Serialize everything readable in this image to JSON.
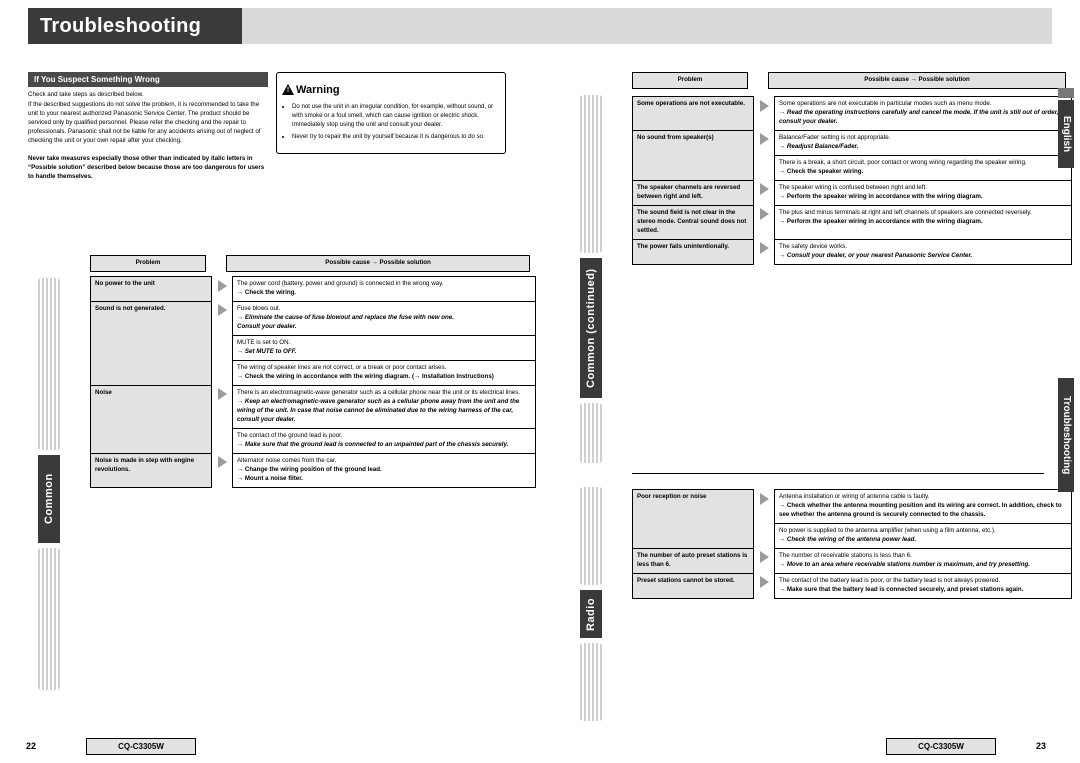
{
  "header": {
    "title": "Troubleshooting"
  },
  "left": {
    "section_title": "If You Suspect Something Wrong",
    "intro": "Check and take steps as described below.",
    "para1": "If the described suggestions do not solve the problem, it is recommended to take the unit to your nearest authorized Panasonic Service Center. The product should be serviced only by qualified personnel. Please refer the checking and the repair to professionals. Panasonic shall not be liable for any accidents arising out of neglect of checking the unit or your own repair after your checking.",
    "para2_bold": "Never take measures especially those other than indicated by italic letters in “Possible solution” described below because those are too dangerous for users to handle themselves.",
    "warning": {
      "title": "Warning",
      "items": [
        "Do not use the unit in an irregular condition, for example, without sound, or with smoke or a foul smell, which can cause ignition or electric shock. Immediately stop using the unit and consult your dealer.",
        "Never try to repair the unit by yourself because it is dangerous to do so."
      ]
    },
    "table_headers": {
      "problem": "Problem",
      "solution": "Possible cause → Possible solution"
    },
    "tab_label": "Common",
    "rows": [
      {
        "problem": "No power to the unit",
        "cells": [
          {
            "cause": "The power cord (battery, power and ground) is connected in the wrong way.",
            "sol": "→ Check the wiring.",
            "sol_style": "bold"
          }
        ]
      },
      {
        "problem": "Sound is not generated.",
        "cells": [
          {
            "cause": "Fuse blows out.",
            "sol": "→ Eliminate the cause of fuse blowout and replace the fuse with new one.",
            "sol2": "Consult your dealer.",
            "sol_style": "bolditalic"
          },
          {
            "cause": "MUTE is set to ON.",
            "sol": "→ Set MUTE to OFF.",
            "sol_style": "bolditalic"
          },
          {
            "cause": "The wiring of speaker lines are not correct, or a break or poor contact arises.",
            "sol": "→ Check the wiring in accordance with the wiring diagram. (→ Installation Instructions)",
            "sol_style": "bold"
          }
        ]
      },
      {
        "problem": "Noise",
        "cells": [
          {
            "cause": "There is an electromagnetic-wave generator such as a cellular phone near the unit or its electrical lines.",
            "sol": "→ Keep an electromagnetic-wave generator such as a cellular phone away from the unit and the wiring of the unit. In case that noise cannot be eliminated due to the wiring harness of the car, consult your dealer.",
            "sol_style": "bolditalic"
          },
          {
            "cause": "The contact of the ground lead is poor.",
            "sol": "→ Make sure that the ground lead is connected to an unpainted part of the chassis securely.",
            "sol_style": "bolditalic"
          }
        ]
      },
      {
        "problem": "Noise is made in step with engine revolutions.",
        "cells": [
          {
            "cause": "Alternator noise comes from the car.",
            "sol": "→ Change the wiring position of the ground lead.",
            "sol2": "→ Mount a noise filter.",
            "sol_style": "bold"
          }
        ]
      }
    ],
    "footer": {
      "page": "22",
      "model": "CQ-C3305W"
    }
  },
  "right": {
    "table_headers": {
      "problem": "Problem",
      "solution": "Possible cause → Possible solution"
    },
    "tab_common": "Common (continued)",
    "tab_radio": "Radio",
    "common_rows": [
      {
        "problem": "Some operations are not executable.",
        "cells": [
          {
            "cause": "Some operations are not executable in particular modes such as menu mode.",
            "sol": "→ Read the operating instructions carefully and cancel the mode. If the unit is still out of order, consult your dealer.",
            "sol_style": "bolditalic"
          }
        ]
      },
      {
        "problem": "No sound from speaker(s)",
        "cells": [
          {
            "cause": "Balance/Fader setting is not appropriate.",
            "sol": "→ Readjust Balance/Fader.",
            "sol_style": "bolditalic"
          },
          {
            "cause": "There is a break, a short circuit, poor contact or wrong wiring regarding the speaker wiring.",
            "sol": "→ Check the speaker wiring.",
            "sol_style": "bold"
          }
        ]
      },
      {
        "problem": "The speaker channels are reversed between right and left.",
        "cells": [
          {
            "cause": "The speaker wiring is confused between right and left.",
            "sol": "→ Perform the speaker wiring in accordance with the wiring diagram.",
            "sol_style": "bold"
          }
        ]
      },
      {
        "problem": "The sound field is not clear in the stereo mode. Central sound does not settled.",
        "cells": [
          {
            "cause": "The plus and minus terminals at right and left channels of speakers are connected reversely.",
            "sol": "→ Perform the speaker wiring in accordance with the wiring diagram.",
            "sol_style": "bold"
          }
        ]
      },
      {
        "problem": "The power fails unintentionally.",
        "cells": [
          {
            "cause": "The safety device works.",
            "sol": "→ Consult your dealer, or your nearest Panasonic Service Center.",
            "sol_style": "bolditalic"
          }
        ]
      }
    ],
    "radio_rows": [
      {
        "problem": "Poor reception or noise",
        "cells": [
          {
            "cause": "Antenna installation or wiring of antenna cable is faulty.",
            "sol": "→ Check whether the antenna mounting position and its wiring are correct. In addition, check to see whether the antenna ground is securely connected to the chassis.",
            "sol_style": "bold"
          },
          {
            "cause": "No power is supplied to the antenna amplifier (when using a film antenna, etc.).",
            "sol": "→ Check the wiring of the antenna power lead.",
            "sol_style": "bolditalic"
          }
        ]
      },
      {
        "problem": "The number of auto preset stations is less than 6.",
        "cells": [
          {
            "cause": "The number of receivable stations is less than 6.",
            "sol": "→ Move to an area where receivable stations number is maximum, and try presetting.",
            "sol_style": "bolditalic"
          }
        ]
      },
      {
        "problem": "Preset stations cannot be stored.",
        "cells": [
          {
            "cause": "The contact of the battery lead is poor, or the battery lead is not always powered.",
            "sol": "→ Make sure that the battery lead is connected securely, and preset stations again.",
            "sol_style": "bold"
          }
        ]
      }
    ],
    "footer": {
      "page": "23",
      "model": "CQ-C3305W"
    },
    "side_tabs": {
      "english": "English",
      "troubleshooting": "Troubleshooting"
    }
  }
}
